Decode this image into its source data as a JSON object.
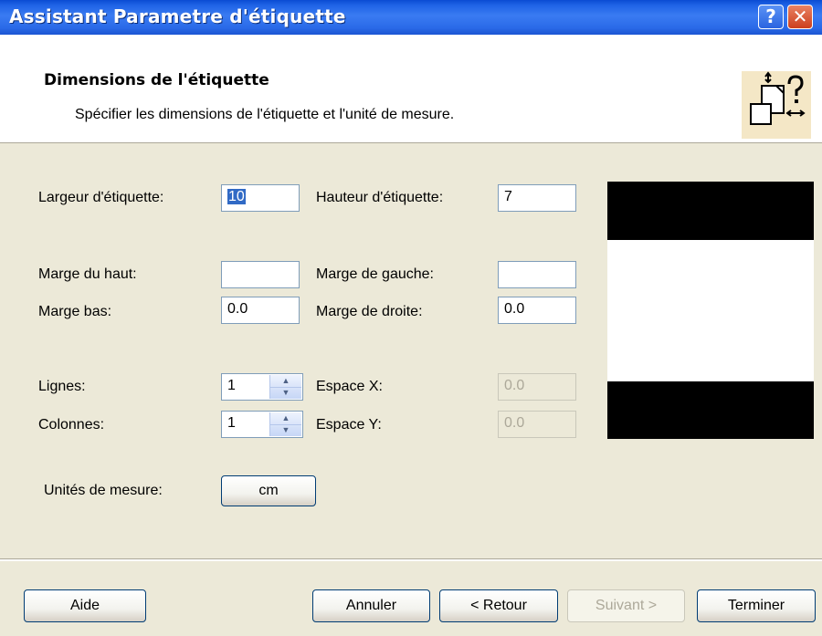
{
  "window": {
    "title": "Assistant Parametre d'étiquette",
    "help_label": "?",
    "close_label": "✕"
  },
  "header": {
    "title": "Dimensions de l'étiquette",
    "subtitle": "Spécifier les dimensions de l'étiquette et l'unité de mesure.",
    "icon": "label-dimensions-wizard-icon"
  },
  "form": {
    "largeur_label": "Largeur d'étiquette:",
    "largeur_value": "10",
    "hauteur_label": "Hauteur d'étiquette:",
    "hauteur_value": "7",
    "marge_haut_label": "Marge du haut:",
    "marge_haut_value": "",
    "marge_gauche_label": "Marge de gauche:",
    "marge_gauche_value": "",
    "marge_bas_label": "Marge bas:",
    "marge_bas_value": "0.0",
    "marge_droite_label": "Marge de droite:",
    "marge_droite_value": "0.0",
    "lignes_label": "Lignes:",
    "lignes_value": "1",
    "espace_x_label": "Espace X:",
    "espace_x_value": "0.0",
    "colonnes_label": "Colonnes:",
    "colonnes_value": "1",
    "espace_y_label": "Espace Y:",
    "espace_y_value": "0.0",
    "unites_label": "Unités de mesure:",
    "unites_button": "cm"
  },
  "footer": {
    "aide": "Aide",
    "annuler": "Annuler",
    "retour": "< Retour",
    "suivant": "Suivant >",
    "terminer": "Terminer"
  }
}
